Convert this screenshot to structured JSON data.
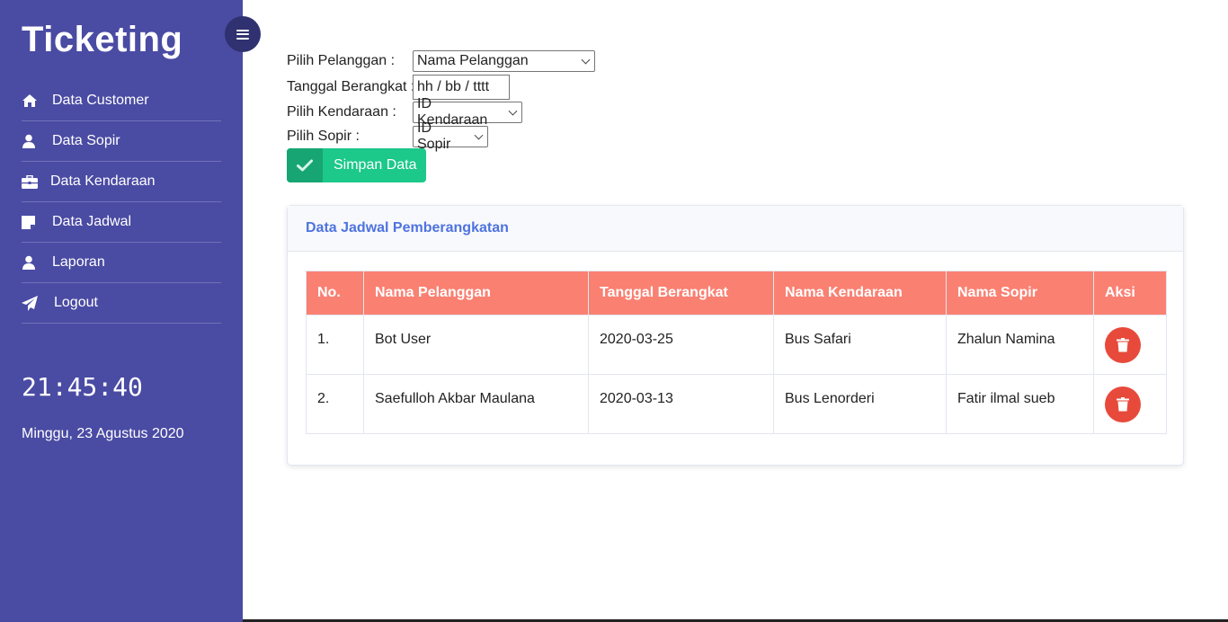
{
  "brand": "Ticketing",
  "sidebar": {
    "items": [
      {
        "label": "Data Customer",
        "icon": "home-icon"
      },
      {
        "label": "Data Sopir",
        "icon": "user-icon"
      },
      {
        "label": "Data Kendaraan",
        "icon": "briefcase-icon"
      },
      {
        "label": "Data Jadwal",
        "icon": "sticky-note-icon"
      },
      {
        "label": "Laporan",
        "icon": "user-icon"
      },
      {
        "label": "Logout",
        "icon": "paper-plane-icon"
      }
    ],
    "clock": "21:45:40",
    "date": "Minggu, 23 Agustus 2020"
  },
  "form": {
    "pelanggan_label": "Pilih Pelanggan :",
    "pelanggan_value": "Nama Pelanggan",
    "tanggal_label": "Tanggal Berangkat :",
    "tanggal_value": "hh / bb / tttt",
    "kendaraan_label": "Pilih Kendaraan :",
    "kendaraan_value": "ID Kendaraan",
    "sopir_label": "Pilih Sopir :",
    "sopir_value": "ID Sopir",
    "save_label": "Simpan Data"
  },
  "card": {
    "title": "Data Jadwal Pemberangkatan",
    "headers": [
      "No.",
      "Nama Pelanggan",
      "Tanggal Berangkat",
      "Nama Kendaraan",
      "Nama Sopir",
      "Aksi"
    ],
    "rows": [
      {
        "no": "1.",
        "pelanggan": "Bot User",
        "tanggal": "2020-03-25",
        "kendaraan": "Bus Safari",
        "sopir": "Zhalun Namina"
      },
      {
        "no": "2.",
        "pelanggan": "Saefulloh Akbar Maulana",
        "tanggal": "2020-03-13",
        "kendaraan": "Bus Lenorderi",
        "sopir": "Fatir ilmal sueb"
      }
    ]
  },
  "colors": {
    "sidebar": "#4a4ba3",
    "accent": "#4e73df",
    "success": "#1cc88a",
    "table_header": "#fa8072",
    "danger": "#e74a3b"
  }
}
